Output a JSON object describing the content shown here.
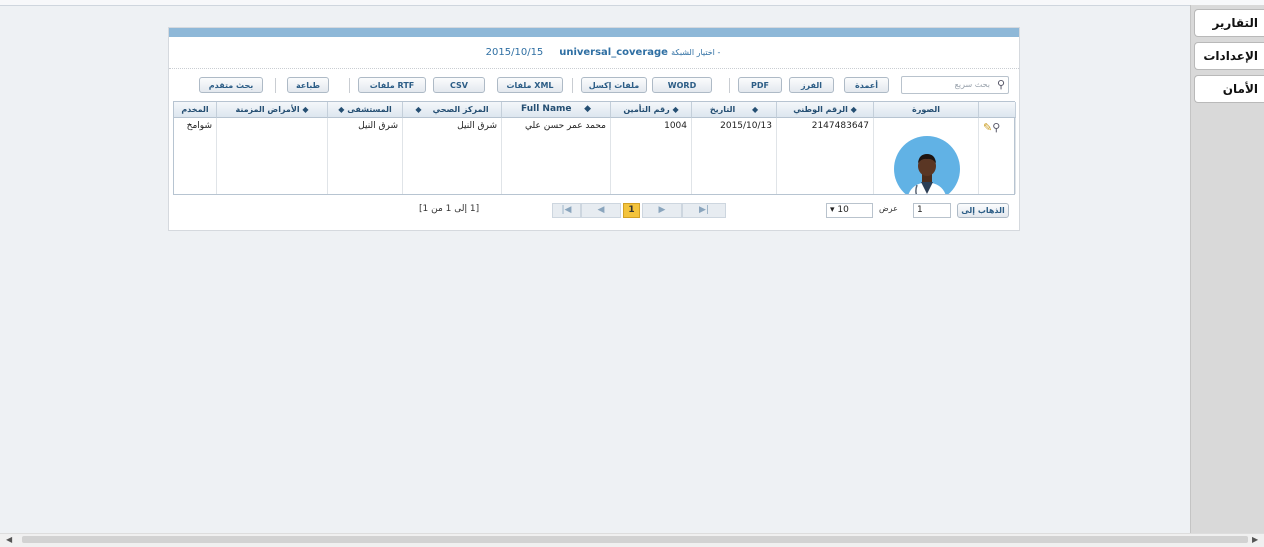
{
  "sidebar": {
    "items": [
      {
        "label": "التقارير"
      },
      {
        "label": "الإعدادات"
      },
      {
        "label": "الأمان"
      }
    ]
  },
  "panel": {
    "caption_date": "2015/10/15",
    "caption_coverage": "universal_coverage",
    "caption_prefix": "اختيار الشبكة -"
  },
  "toolbar": {
    "search_placeholder": "بحث سريع",
    "columns_label": "أعمدة",
    "sort_label": "الفرز",
    "pdf_label": "PDF",
    "word_label": "WORD",
    "excel_label": "ملفات إكسل",
    "xml_label": "ملفات XML",
    "csv_label": "CSV",
    "rtf_label": "ملفات RTF",
    "print_label": "طباعة",
    "advanced_search_label": "بحث متقدم"
  },
  "table": {
    "headers": {
      "photo": "الصورة",
      "national_id": "◆ الرقم الوطني",
      "date": "التاريخ",
      "insurance_no": "◆ رقم التأمين",
      "full_name": "Full Name",
      "health_center": "المركز الصحي",
      "hospital": "المستشفى",
      "chronic_diseases": "◆ الأمراض المزمنة",
      "user": "المخدم"
    },
    "rows": [
      {
        "national_id": "2147483647",
        "date": "2015/10/13",
        "insurance_no": "1004",
        "full_name": "محمد عمر حسن علي",
        "health_center": "شرق النيل",
        "hospital": "شرق النيل",
        "chronic_diseases": "",
        "user": "شوامخ"
      }
    ]
  },
  "pager": {
    "page_info": "[1 إلى 1 من 1]",
    "current_page": "1",
    "goto_label": "الذهاب إلى",
    "goto_value": "1",
    "show_label": "عرض",
    "rows_per_page": "10"
  },
  "colors": {
    "accent": "#8eb8d8",
    "header_text": "#244e72",
    "active_page": "#f3c33c",
    "avatar_bg": "#61b2e5"
  }
}
